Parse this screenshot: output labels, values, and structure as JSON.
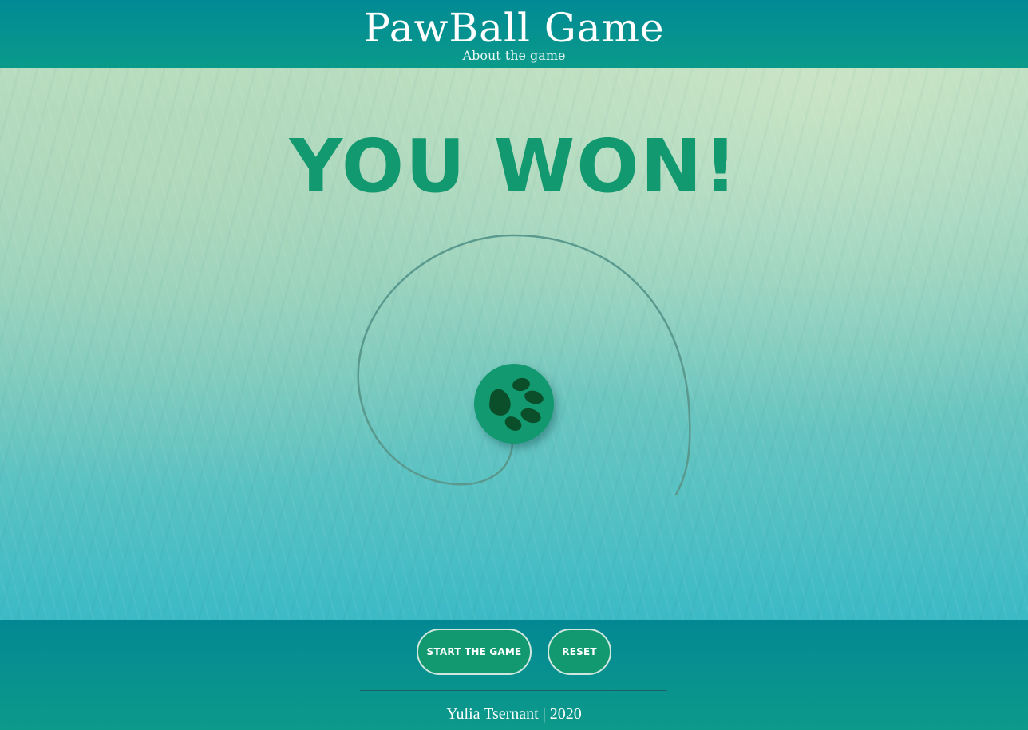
{
  "header": {
    "title": "PawBall Game",
    "subtitle": "About the game"
  },
  "game": {
    "status_text": "YOU WON!",
    "ball_icon": "paw-icon",
    "colors": {
      "ball": "#12996f",
      "paw": "#0a4f2a",
      "status_text": "#12996f",
      "spiral": "#5a9a8e"
    }
  },
  "controls": {
    "start_label": "START THE GAME",
    "reset_label": "RESET"
  },
  "footer": {
    "credit": "Yulia Tsernant | 2020"
  }
}
